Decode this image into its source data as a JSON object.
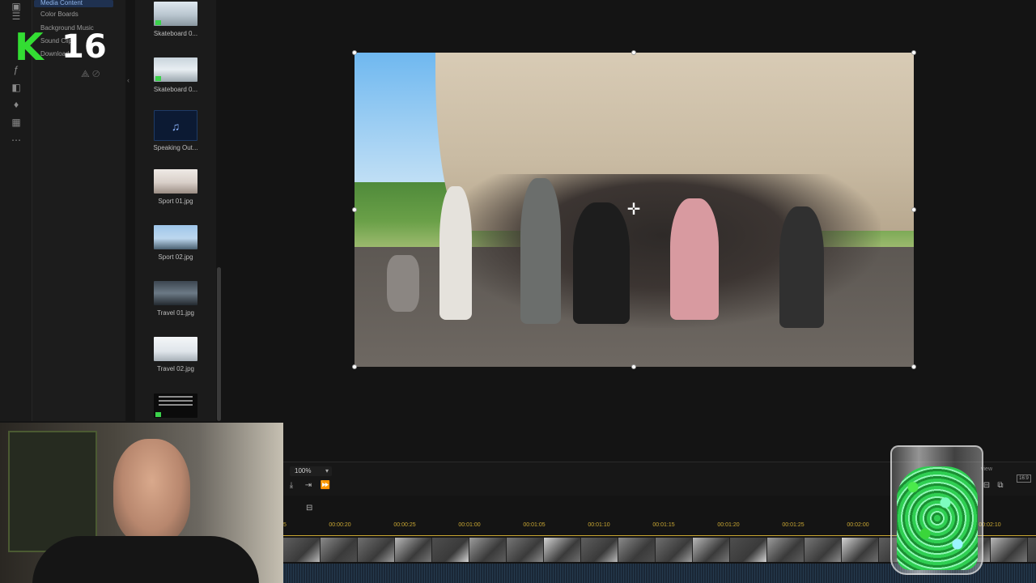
{
  "categories": {
    "active": "Media Content",
    "items": [
      "Color Boards",
      "Background Music",
      "Sound Clips",
      "Downloaded"
    ]
  },
  "logo": {
    "letter": "K",
    "number": "16"
  },
  "library": {
    "items": [
      {
        "label": "Skateboard 0...",
        "thumb": "skateboard-thumb",
        "downloaded": true
      },
      {
        "label": "Skateboard 0...",
        "thumb": "skateboard-thumb",
        "downloaded": true
      },
      {
        "label": "Speaking Out...",
        "thumb": "music-note-icon",
        "downloaded": false
      },
      {
        "label": "Sport 01.jpg",
        "thumb": "sport-thumb",
        "downloaded": false
      },
      {
        "label": "Sport 02.jpg",
        "thumb": "sport-thumb",
        "downloaded": false
      },
      {
        "label": "Travel 01.jpg",
        "thumb": "travel-thumb",
        "downloaded": false
      },
      {
        "label": "Travel 02.jpg",
        "thumb": "travel-thumb",
        "downloaded": false
      },
      {
        "label": "",
        "thumb": "text-slide-thumb",
        "downloaded": true
      }
    ]
  },
  "timeline": {
    "zoom": "100%",
    "start_tick": "5",
    "ticks": [
      "00:00:20",
      "00:00:25",
      "00:01:00",
      "00:01:05",
      "00:01:10",
      "00:01:15",
      "00:01:20",
      "00:01:25",
      "00:02:00",
      "00:02:10"
    ],
    "right_label": "view",
    "aspect": "16:9"
  },
  "colors": {
    "accent": "#c9a733",
    "logo_green": "#33dd33",
    "active_category": "#1f3150"
  }
}
